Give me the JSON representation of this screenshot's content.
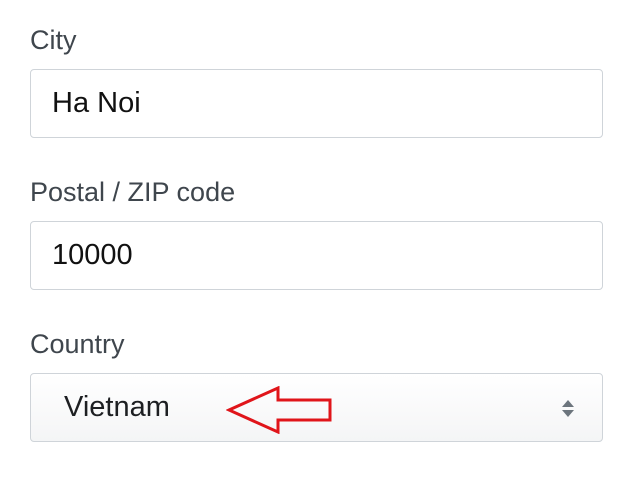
{
  "form": {
    "city": {
      "label": "City",
      "value": "Ha Noi"
    },
    "postal": {
      "label": "Postal / ZIP code",
      "value": "10000"
    },
    "country": {
      "label": "Country",
      "selected": "Vietnam",
      "icon": "select-arrows-icon"
    }
  },
  "annotation": {
    "icon": "left-arrow-annotation",
    "color": "#e0151a"
  },
  "colors": {
    "border": "#cfd4d9",
    "label": "#3f464d",
    "text": "#111111"
  }
}
